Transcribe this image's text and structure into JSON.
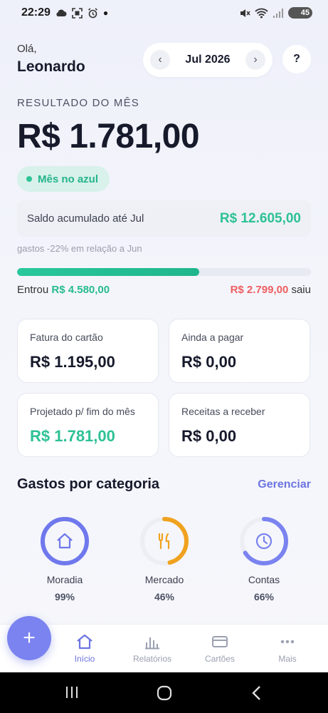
{
  "status_bar": {
    "time": "22:29",
    "battery": "45"
  },
  "header": {
    "greeting": "Olá,",
    "user_name": "Leonardo",
    "month": "Jul 2026",
    "prev_label": "‹",
    "next_label": "›",
    "help_label": "?"
  },
  "summary": {
    "result_label": "RESULTADO DO MÊS",
    "result_value": "R$ 1.781,00",
    "status_chip": "Mês no azul",
    "saldo_label": "Saldo acumulado até Jul",
    "saldo_value": "R$ 12.605,00",
    "compare_note": "gastos -22% em relação a Jun",
    "income_share": 0.62,
    "in_prefix": "Entrou",
    "in_value": "R$ 4.580,00",
    "out_value": "R$ 2.799,00",
    "out_suffix": "saiu"
  },
  "cards": [
    {
      "label": "Fatura do cartão",
      "value": "R$ 1.195,00"
    },
    {
      "label": "Ainda a pagar",
      "value": "R$ 0,00"
    },
    {
      "label": "Projetado p/ fim do mês",
      "value": "R$ 1.781,00"
    },
    {
      "label": "Receitas a receber",
      "value": "R$ 0,00"
    }
  ],
  "categories_section": {
    "title": "Gastos por categoria",
    "manage_label": "Gerenciar",
    "items": [
      {
        "name": "Moradia",
        "percent_label": "99%",
        "percent": 99,
        "color": "#6f78ec",
        "icon": "house-icon"
      },
      {
        "name": "Mercado",
        "percent_label": "46%",
        "percent": 46,
        "color": "#f0a21f",
        "icon": "utensils-icon"
      },
      {
        "name": "Contas",
        "percent_label": "66%",
        "percent": 66,
        "color": "#7a83ef",
        "icon": "clock-icon"
      }
    ]
  },
  "fab_label": "+",
  "bottom_nav": [
    {
      "label": "Início",
      "icon": "home-icon",
      "active": true
    },
    {
      "label": "Relatórios",
      "icon": "bar-chart-icon",
      "active": false
    },
    {
      "label": "Cartões",
      "icon": "credit-card-icon",
      "active": false
    },
    {
      "label": "Mais",
      "icon": "more-icon",
      "active": false
    }
  ],
  "colors": {
    "accent": "#6c74e0",
    "positive": "#2dc196",
    "negative": "#ee5e61"
  }
}
